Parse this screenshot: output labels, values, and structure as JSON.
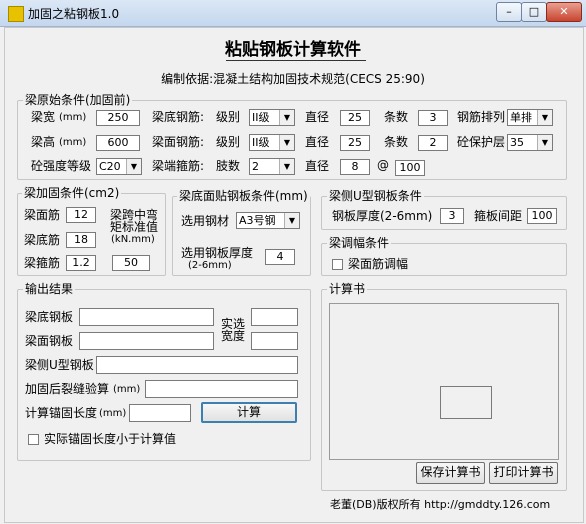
{
  "window": {
    "title": "加固之粘钢板1.0",
    "min": "–",
    "max": "□",
    "close": "✕"
  },
  "header": {
    "title": "粘贴钢板计算软件",
    "basis": "编制依据:混凝土结构加固技术规范(CECS 25:90)"
  },
  "original": {
    "title": "梁原始条件(加固前)",
    "width_label": "梁宽",
    "width_unit": "(mm)",
    "width_value": "250",
    "height_label": "梁高",
    "height_unit": "(mm)",
    "height_value": "600",
    "concrete_label": "砼强度等级",
    "concrete_value": "C20",
    "bottom_label": "梁底钢筋:",
    "bottom_grade_label": "级别",
    "bottom_grade": "II级",
    "bottom_dia_label": "直径",
    "bottom_dia": "25",
    "bottom_count_label": "条数",
    "bottom_count": "3",
    "arrange_label": "钢筋排列",
    "arrange_value": "单排",
    "top_label": "梁面钢筋:",
    "top_grade_label": "级别",
    "top_grade": "II级",
    "top_dia_label": "直径",
    "top_dia": "25",
    "top_count_label": "条数",
    "top_count": "2",
    "cover_label": "砼保护层",
    "cover_value": "35",
    "stirrup_label": "梁端箍筋:",
    "stirrup_legs_label": "肢数",
    "stirrup_legs": "2",
    "stirrup_dia_label": "直径",
    "stirrup_dia": "8",
    "stirrup_at": "@",
    "stirrup_spacing": "100"
  },
  "reinforced": {
    "title": "梁加固条件(cm2)",
    "top_label": "梁面筋",
    "top_value": "12",
    "bottom_label": "梁底筋",
    "bottom_value": "18",
    "stirrup_label": "梁箍筋",
    "stirrup_value": "1.2",
    "moment_line1": "梁跨中弯",
    "moment_line2": "矩标准值",
    "moment_unit": "(kN.mm)",
    "moment_value": "50"
  },
  "bottom_plate": {
    "title": "梁底面贴钢板条件(mm)",
    "steel_label": "选用钢材",
    "steel_value": "A3号钢",
    "thickness_label": "选用钢板厚度",
    "thickness_range": "(2-6mm)",
    "thickness_value": "4"
  },
  "side_plate": {
    "title": "梁侧U型钢板条件",
    "thickness_label": "钢板厚度(2-6mm)",
    "thickness_value": "3",
    "spacing_label": "箍板间距",
    "spacing_value": "100"
  },
  "moment_adjust": {
    "title": "梁调幅条件",
    "checkbox_label": "梁面筋调幅"
  },
  "output": {
    "title": "输出结果",
    "bottom_plate_label": "梁底钢板",
    "bottom_plate_value": "",
    "top_plate_label": "梁面钢板",
    "top_plate_value": "",
    "width_label_1": "实选",
    "width_label_2": "宽度",
    "width_value_1": "",
    "width_value_2": "",
    "side_plate_label": "梁侧U型钢板",
    "side_plate_value": "",
    "crack_label": "加固后裂缝验算",
    "crack_unit": "(mm)",
    "crack_value": "",
    "anchor_label": "计算锚固长度",
    "anchor_unit": "(mm)",
    "anchor_value": "",
    "calc_button": "计算",
    "anchor_check_label": "实际锚固长度小于计算值"
  },
  "calc_book": {
    "title": "计算书",
    "save_button": "保存计算书",
    "print_button": "打印计算书"
  },
  "footer": {
    "copyright": "老董(DB)版权所有 http://gmddty.126.com"
  }
}
